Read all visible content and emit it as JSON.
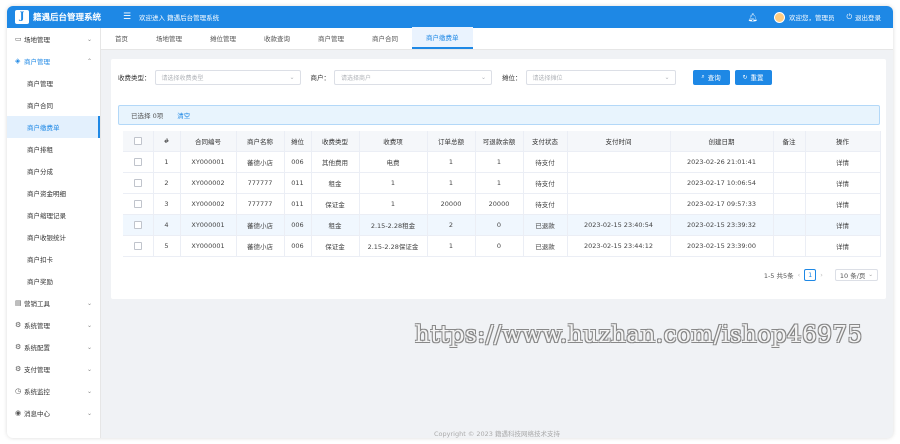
{
  "header": {
    "logo_letter": "J",
    "app_title": "籍遇后台管理系统",
    "collapse_icon": "menu-collapse-icon",
    "welcome": "欢迎进入 籍遇后台管理系统",
    "user_text": "欢迎您，管理员",
    "logout": "退出登录"
  },
  "sidebar": {
    "groups_top": [
      {
        "label": "场地管理",
        "icon": "venue-icon"
      }
    ],
    "merchant_group": {
      "label": "商户管理",
      "icon": "merchant-icon"
    },
    "merchant_items": [
      {
        "label": "商户管理"
      },
      {
        "label": "商户合同"
      },
      {
        "label": "商户缴费单"
      },
      {
        "label": "商户排租"
      },
      {
        "label": "商户分成"
      },
      {
        "label": "商户资金明细"
      },
      {
        "label": "商户缩理记录"
      },
      {
        "label": "商户收银统计"
      },
      {
        "label": "商户扣卡"
      },
      {
        "label": "商户奖励"
      }
    ],
    "groups_bottom": [
      {
        "label": "营销工具",
        "icon": "marketing-icon"
      },
      {
        "label": "系统管理",
        "icon": "settings-icon"
      },
      {
        "label": "系统配置",
        "icon": "config-icon"
      },
      {
        "label": "支付管理",
        "icon": "payment-icon"
      },
      {
        "label": "系统监控",
        "icon": "monitor-icon"
      },
      {
        "label": "消息中心",
        "icon": "message-icon"
      }
    ]
  },
  "tabs": [
    {
      "label": "首页"
    },
    {
      "label": "场地管理"
    },
    {
      "label": "摊位管理"
    },
    {
      "label": "收款查询"
    },
    {
      "label": "商户管理"
    },
    {
      "label": "商户合同"
    },
    {
      "label": "商户缴费单"
    }
  ],
  "filters": {
    "type_label": "收费类型：",
    "type_placeholder": "请选择收费类型",
    "merchant_label": "商户：",
    "merchant_placeholder": "请选择商户",
    "booth_label": "摊位：",
    "booth_placeholder": "请选择摊位",
    "search_btn": "查询",
    "reset_btn": "重置"
  },
  "selection": {
    "text": "已选择 0项",
    "clear": "清空"
  },
  "table": {
    "headers": [
      "#",
      "合同编号",
      "商户名称",
      "摊位",
      "收费类型",
      "收费项",
      "订单总额",
      "可退款余额",
      "支付状态",
      "支付时间",
      "创建日期",
      "备注",
      "操作"
    ],
    "rows": [
      [
        "1",
        "XY000001",
        "蕃德小店",
        "006",
        "其他费用",
        "电费",
        "1",
        "1",
        "待支付",
        "",
        "2023-02-26 21:01:41",
        "",
        "详情"
      ],
      [
        "2",
        "XY000002",
        "777777",
        "011",
        "租金",
        "1",
        "1",
        "1",
        "待支付",
        "",
        "2023-02-17 10:06:54",
        "",
        "详情"
      ],
      [
        "3",
        "XY000002",
        "777777",
        "011",
        "保证金",
        "1",
        "20000",
        "20000",
        "待支付",
        "",
        "2023-02-17 09:57:33",
        "",
        "详情"
      ],
      [
        "4",
        "XY000001",
        "蕃德小店",
        "006",
        "租金",
        "2.15-2.28租金",
        "2",
        "0",
        "已退款",
        "2023-02-15 23:40:54",
        "2023-02-15 23:39:32",
        "",
        "详情"
      ],
      [
        "5",
        "XY000001",
        "蕃德小店",
        "006",
        "保证金",
        "2.15-2.28保证金",
        "1",
        "0",
        "已退款",
        "2023-02-15 23:44:12",
        "2023-02-15 23:39:00",
        "",
        "详情"
      ]
    ]
  },
  "pagination": {
    "summary": "1-5 共5条",
    "current_page": "1",
    "page_size": "10 条/页"
  },
  "footer": {
    "copyright": "Copyright © 2023 籍遇科技网络技术支持"
  },
  "watermark": "https://www.huzhan.com/ishop46975",
  "colors": {
    "primary": "#1e88e5",
    "sidebar_active_bg": "#e3f0fd"
  }
}
